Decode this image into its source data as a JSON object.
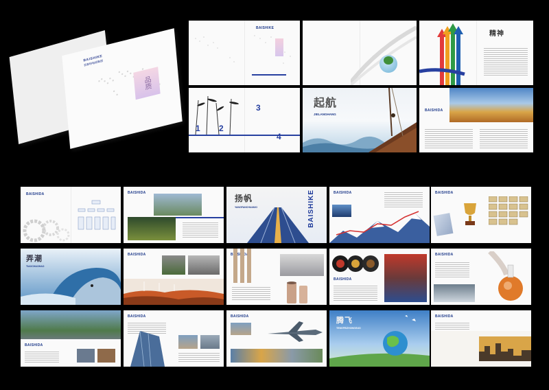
{
  "brand": {
    "logo_text": "BAISHIKE",
    "company_line": "百事特电缆集团"
  },
  "cover": {
    "vertical_title": "品质"
  },
  "row1": {
    "p3_heading": "BAISHIKE",
    "p3_num_1": "1",
    "p3_num_2": "2",
    "p3_num_3": "3",
    "p3_num_4": "4",
    "p4_title": "起航",
    "p4_pinyin": "JIELANGHANG",
    "p5_heading": "精神",
    "p6_heading": "BAISHIDA"
  },
  "row2": {
    "p1_heading": "BAISHIDA",
    "p2_heading": "BAISHIDA",
    "p3_title": "扬帆",
    "p3_pinyin": "YANGFANCHUANXI",
    "p3_brand_vertical": "BAISHIKE",
    "p4_heading": "BAISHIDA",
    "p5_heading": "BAISHIDA"
  },
  "row3": {
    "p1_title": "弄潮",
    "p1_pinyin": "TIAOCHAOHAO",
    "p2_heading": "BAISHIDA",
    "p3_heading": "BAISHIDA",
    "p4_heading": "BAISHIDA",
    "p5_heading": "BAISHIDA",
    "p6_heading": "BAISHIDA"
  },
  "row4": {
    "p1_heading": "BAISHIDA",
    "p2_heading": "BAISHIDA",
    "p3_heading": "BAISHIDA",
    "p4_title": "腾飞",
    "p4_pinyin": "TENGFEIZHONGGUO",
    "p5_heading": "BAISHIDA"
  },
  "colors": {
    "background": "#000000",
    "brand_blue": "#2740a0",
    "page_white": "#fafafa"
  }
}
